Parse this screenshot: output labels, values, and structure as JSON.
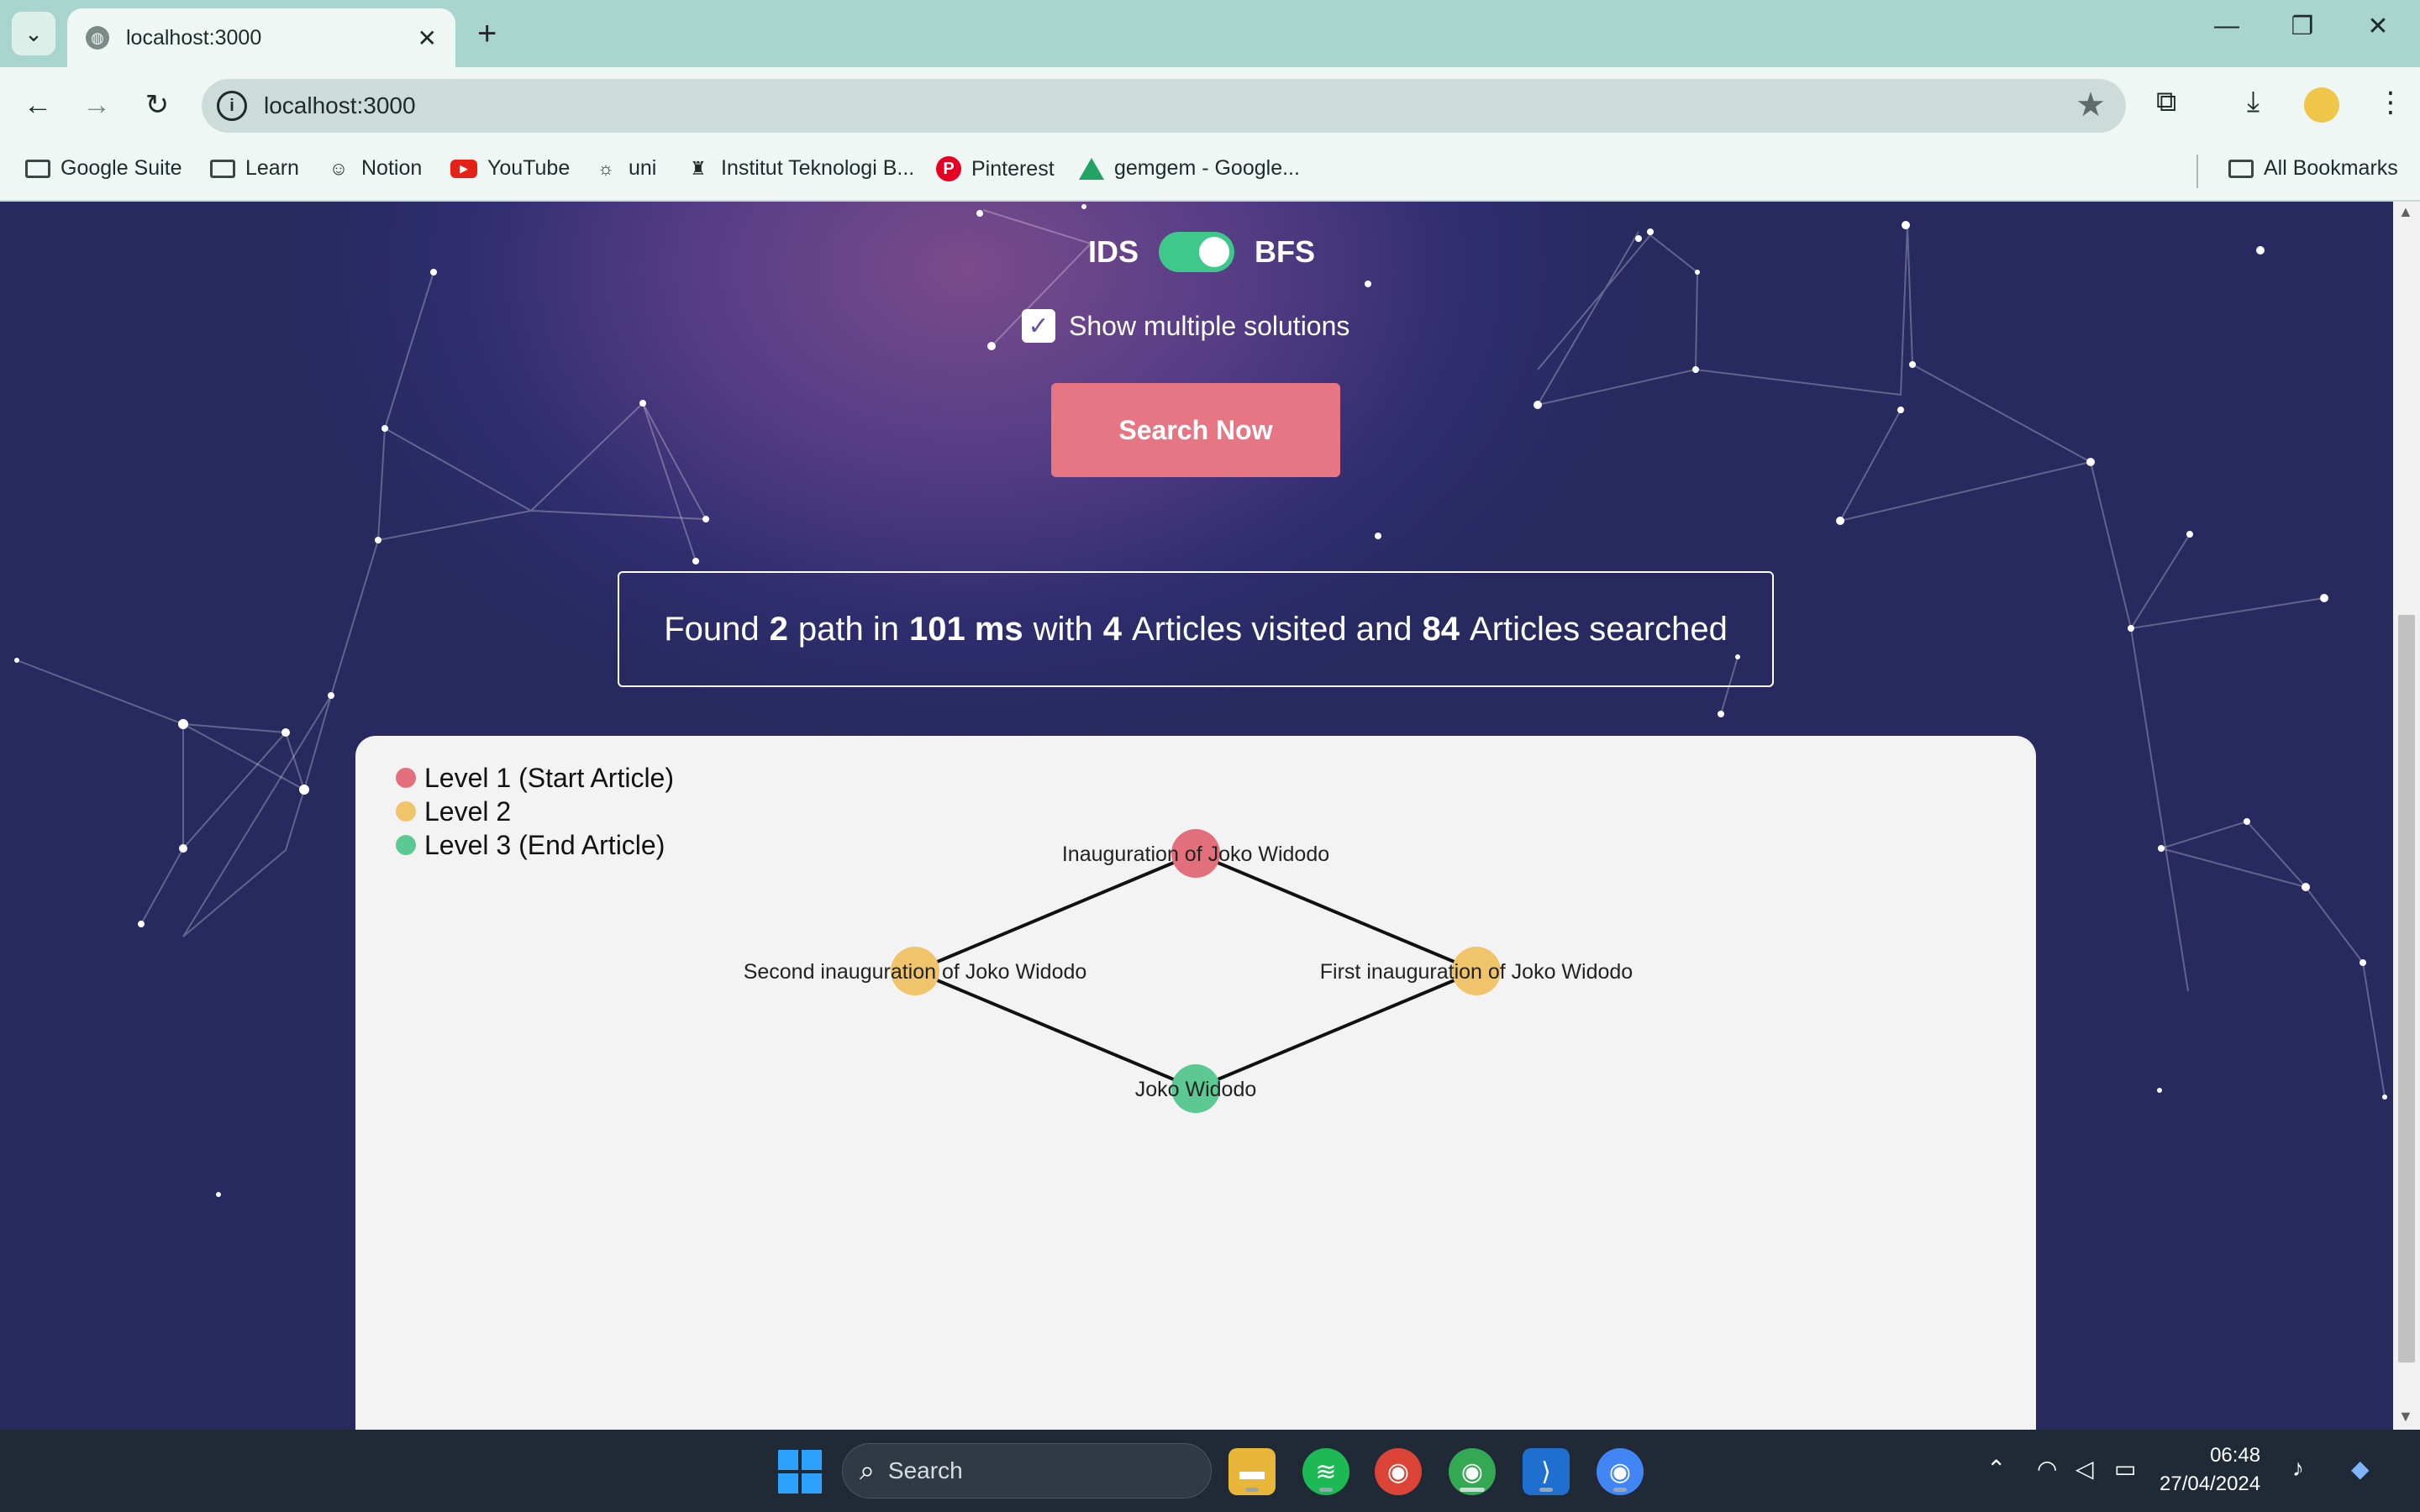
{
  "browser": {
    "tab_title": "localhost:3000",
    "url": "localhost:3000",
    "bookmarks": [
      {
        "label": "Google Suite",
        "icon": "folder-icon"
      },
      {
        "label": "Learn",
        "icon": "folder-icon"
      },
      {
        "label": "Notion",
        "icon": "notion-icon"
      },
      {
        "label": "YouTube",
        "icon": "youtube-icon"
      },
      {
        "label": "uni",
        "icon": "uni-icon"
      },
      {
        "label": "Institut Teknologi B...",
        "icon": "itb-icon"
      },
      {
        "label": "Pinterest",
        "icon": "pinterest-icon"
      },
      {
        "label": "gemgem - Google...",
        "icon": "drive-icon"
      }
    ],
    "all_bookmarks": "All Bookmarks"
  },
  "controls": {
    "algo_left": "IDS",
    "algo_right": "BFS",
    "algo_selected": "BFS",
    "multi_label": "Show multiple solutions",
    "multi_checked": true,
    "search_button": "Search Now"
  },
  "result": {
    "prefix": "Found",
    "paths": "2",
    "mid1": "path in",
    "time": "101 ms",
    "mid2": "with",
    "visited": "4",
    "mid3": "Articles visited and",
    "searched": "84",
    "suffix": "Articles searched"
  },
  "legend": [
    {
      "label": "Level 1 (Start Article)",
      "color": "#e46f7c"
    },
    {
      "label": "Level 2",
      "color": "#f0c46a"
    },
    {
      "label": "Level 3 (End Article)",
      "color": "#5cc892"
    }
  ],
  "graph": {
    "nodes": [
      {
        "id": "start",
        "label": "Inauguration of Joko Widodo",
        "level": 1
      },
      {
        "id": "second",
        "label": "Second inauguration of Joko Widodo",
        "level": 2
      },
      {
        "id": "first",
        "label": "First inauguration of Joko Widodo",
        "level": 2
      },
      {
        "id": "end",
        "label": "Joko Widodo",
        "level": 3
      }
    ],
    "edges": [
      [
        "start",
        "second"
      ],
      [
        "start",
        "first"
      ],
      [
        "second",
        "end"
      ],
      [
        "first",
        "end"
      ]
    ]
  },
  "taskbar": {
    "search_placeholder": "Search",
    "time": "06:48",
    "date": "27/04/2024"
  }
}
